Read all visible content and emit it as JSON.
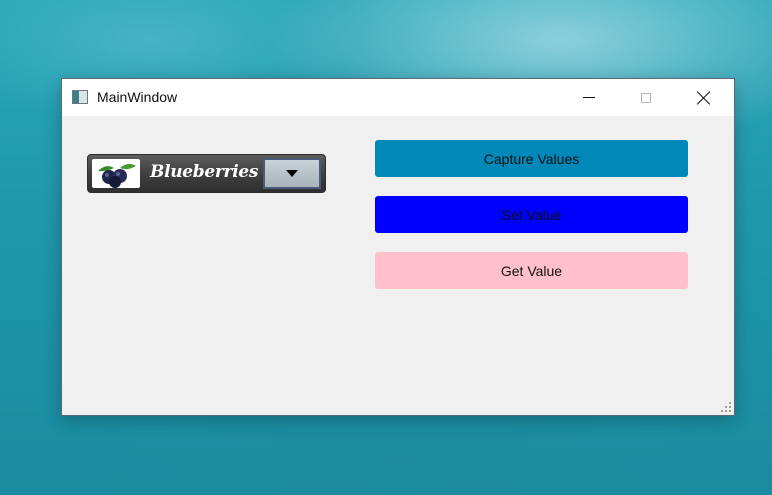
{
  "window": {
    "title": "MainWindow"
  },
  "combo": {
    "selected_label": "Blueberries",
    "thumbnail": "blueberries-image"
  },
  "buttons": {
    "capture_label": "Capture Values",
    "set_label": "Set Value",
    "get_label": "Get Value"
  },
  "colors": {
    "capture_bg": "#0088b8",
    "set_bg": "#0000ff",
    "get_bg": "#ffc0cb",
    "window_bg": "#f0f0f0"
  },
  "icons": {
    "app": "app-window-icon",
    "minimize": "minimize-icon",
    "maximize": "maximize-icon",
    "close": "close-icon",
    "dropdown": "chevron-down-icon",
    "grip": "resize-grip-icon"
  }
}
